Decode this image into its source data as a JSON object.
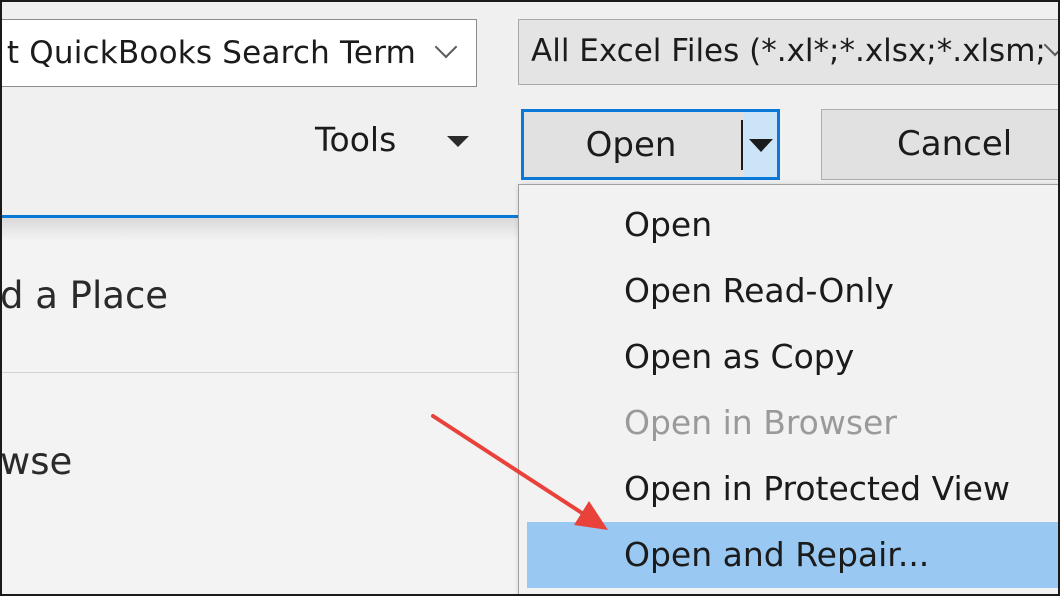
{
  "search": {
    "value": "t QuickBooks Search Term"
  },
  "file_filter": {
    "value": "All Excel Files (*.xl*;*.xlsx;*.xlsm;"
  },
  "toolbar": {
    "tools_label": "Tools",
    "open_label": "Open",
    "cancel_label": "Cancel"
  },
  "backstage": {
    "add_place_label": "d a Place",
    "browse_label": "wse"
  },
  "open_menu": {
    "items": [
      {
        "label": "Open",
        "state": "enabled"
      },
      {
        "label": "Open Read-Only",
        "state": "enabled"
      },
      {
        "label": "Open as Copy",
        "state": "enabled"
      },
      {
        "label": "Open in Browser",
        "state": "disabled"
      },
      {
        "label": "Open in Protected View",
        "state": "enabled"
      },
      {
        "label": "Open and Repair...",
        "state": "highlighted"
      }
    ]
  },
  "colors": {
    "focus_blue": "#0a78d7",
    "highlight_blue": "#99c9f2",
    "annotation_arrow": "#e8423a"
  }
}
